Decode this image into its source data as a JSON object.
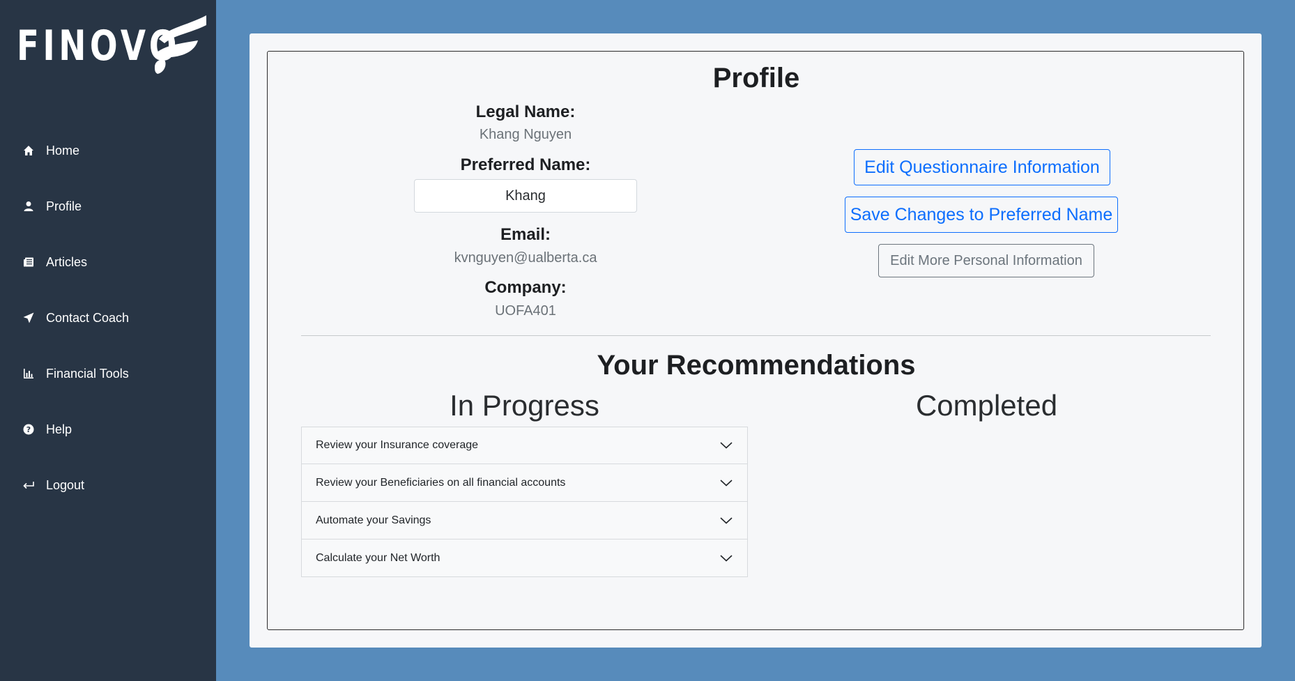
{
  "app": {
    "logo_text": "FINOVO"
  },
  "sidebar": {
    "items": [
      {
        "label": "Home",
        "icon": "home-icon"
      },
      {
        "label": "Profile",
        "icon": "user-icon"
      },
      {
        "label": "Articles",
        "icon": "newspaper-icon"
      },
      {
        "label": "Contact Coach",
        "icon": "paper-plane-icon"
      },
      {
        "label": "Financial Tools",
        "icon": "bar-chart-icon"
      },
      {
        "label": "Help",
        "icon": "question-circle-icon"
      },
      {
        "label": "Logout",
        "icon": "logout-arrow-icon"
      }
    ]
  },
  "profile": {
    "title": "Profile",
    "legal_name_label": "Legal Name:",
    "legal_name": "Khang Nguyen",
    "preferred_name_label": "Preferred Name:",
    "preferred_name": "Khang",
    "email_label": "Email:",
    "email": "kvnguyen@ualberta.ca",
    "company_label": "Company:",
    "company": "UOFA401"
  },
  "actions": {
    "edit_questionnaire": "Edit Questionnaire Information",
    "save_preferred": "Save Changes to Preferred Name",
    "edit_personal": "Edit More Personal Information"
  },
  "recommendations": {
    "title": "Your Recommendations",
    "in_progress_title": "In Progress",
    "completed_title": "Completed",
    "in_progress": [
      "Review your Insurance coverage",
      "Review your Beneficiaries on all financial accounts",
      "Automate your Savings",
      "Calculate your Net Worth"
    ]
  },
  "colors": {
    "background": "#578bbb",
    "sidebar": "#283545",
    "card": "#f6f7f9",
    "primary": "#0d6efd",
    "secondary": "#6c757d"
  }
}
